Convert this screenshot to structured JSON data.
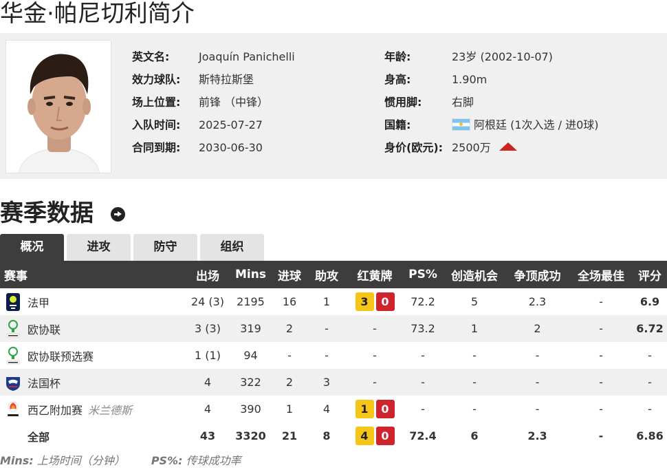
{
  "page_title": "华金·帕尼切利简介",
  "profile": {
    "left": [
      {
        "label": "英文名:",
        "value": "Joaquín Panichelli"
      },
      {
        "label": "效力球队:",
        "value": "斯特拉斯堡"
      },
      {
        "label": "场上位置:",
        "value": "前锋 （中锋）"
      },
      {
        "label": "入队时间:",
        "value": "2025-07-27"
      },
      {
        "label": "合同到期:",
        "value": "2030-06-30"
      }
    ],
    "right": [
      {
        "label": "年龄:",
        "value": "23岁  (2002-10-07)"
      },
      {
        "label": "身高:",
        "value": "1.90m"
      },
      {
        "label": "惯用脚:",
        "value": "右脚"
      },
      {
        "label": "国籍:",
        "value": "阿根廷 (1次入选 / 进0球)",
        "flag": "argentina-flag"
      },
      {
        "label": "身价(欧元):",
        "value": "2500万",
        "trend_icon": "up-arrow-icon",
        "trend_color": "#cc2222"
      }
    ]
  },
  "section_title": "赛季数据",
  "tabs": [
    "概况",
    "进攻",
    "防守",
    "组织"
  ],
  "table": {
    "headers": [
      "赛事",
      "出场",
      "Mins",
      "进球",
      "助攻",
      "红黄牌",
      "PS%",
      "创造机会",
      "争顶成功",
      "全场最佳",
      "评分"
    ],
    "rows": [
      {
        "icon": "ligue1-logo-icon",
        "competition": "法甲",
        "note": "",
        "apps": "24 (3)",
        "mins": "2195",
        "goals": "16",
        "assists": "1",
        "yellow": "3",
        "red": "0",
        "cards": "",
        "ps": "72.2",
        "chances": "5",
        "aerials": "2.3",
        "motm": "-",
        "rating": "6.9"
      },
      {
        "icon": "europa-conference-logo-icon",
        "competition": "欧协联",
        "note": "",
        "apps": "3 (3)",
        "mins": "319",
        "goals": "2",
        "assists": "-",
        "yellow": "",
        "red": "",
        "cards": "-",
        "ps": "73.2",
        "chances": "1",
        "aerials": "2",
        "motm": "-",
        "rating": "6.72"
      },
      {
        "icon": "europa-conference-logo-icon",
        "competition": "欧协联预选赛",
        "note": "",
        "apps": "1 (1)",
        "mins": "94",
        "goals": "-",
        "assists": "-",
        "yellow": "",
        "red": "",
        "cards": "-",
        "ps": "-",
        "chances": "-",
        "aerials": "-",
        "motm": "-",
        "rating": "-"
      },
      {
        "icon": "coupe-de-france-logo-icon",
        "competition": "法国杯",
        "note": "",
        "apps": "4",
        "mins": "322",
        "goals": "2",
        "assists": "3",
        "yellow": "",
        "red": "",
        "cards": "-",
        "ps": "-",
        "chances": "-",
        "aerials": "-",
        "motm": "-",
        "rating": "-"
      },
      {
        "icon": "laliga-logo-icon",
        "competition": "西乙附加赛",
        "note": "米兰德斯",
        "apps": "4",
        "mins": "390",
        "goals": "1",
        "assists": "4",
        "yellow": "1",
        "red": "0",
        "cards": "",
        "ps": "-",
        "chances": "-",
        "aerials": "-",
        "motm": "-",
        "rating": "-"
      }
    ],
    "total": {
      "competition": "全部",
      "apps": "43",
      "mins": "3320",
      "goals": "21",
      "assists": "8",
      "yellow": "4",
      "red": "0",
      "ps": "72.4",
      "chances": "6",
      "aerials": "2.3",
      "motm": "-",
      "rating": "6.86"
    }
  },
  "footnote": {
    "mins_key": "Mins:",
    "mins_desc": " 上场时间（分钟）",
    "ps_key": "PS%:",
    "ps_desc": " 传球成功率"
  },
  "colors": {
    "header_bg": "#3d3d3d",
    "rating": "#e06f1f",
    "yellow_card": "#f5c518",
    "red_card": "#d0232b"
  }
}
